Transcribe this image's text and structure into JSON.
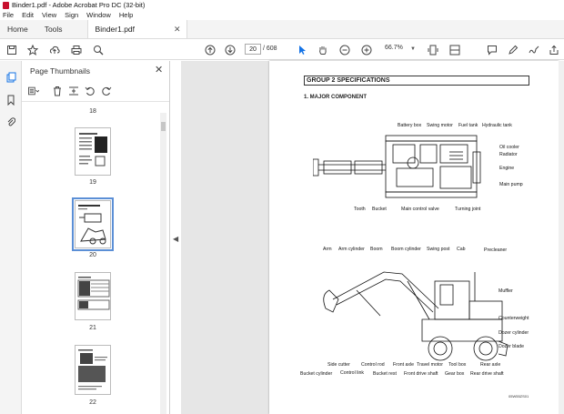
{
  "window": {
    "title": "Binder1.pdf - Adobe Acrobat Pro DC (32-bit)"
  },
  "menu": [
    "File",
    "Edit",
    "View",
    "Sign",
    "Window",
    "Help"
  ],
  "tabs": {
    "home": "Home",
    "tools": "Tools",
    "doc": "Binder1.pdf"
  },
  "toolbar": {
    "page_current": "20",
    "page_total": "/ 608",
    "zoom": "66.7%"
  },
  "thumbnails": {
    "title": "Page Thumbnails",
    "pages": [
      {
        "label": "18"
      },
      {
        "label": "19"
      },
      {
        "label": "20"
      },
      {
        "label": "21"
      },
      {
        "label": "22"
      }
    ]
  },
  "document": {
    "heading": "GROUP 2  SPECIFICATIONS",
    "subheading": "1. MAJOR COMPONENT",
    "top_labels": [
      "Battery box",
      "Swing motor",
      "Fuel tank",
      "Hydraulic tank",
      "Oil cooler",
      "Radiator",
      "Engine",
      "Main pump",
      "Tooth",
      "Bucket",
      "Main control valve",
      "Turning joint"
    ],
    "side_labels": [
      "Arm",
      "Arm cylinder",
      "Boom",
      "Boom cylinder",
      "Swing post",
      "Cab",
      "Precleaner",
      "Muffler",
      "Counterweight",
      "Dozer cylinder",
      "Dozer blade",
      "Side cutter",
      "Control rod",
      "Front axle",
      "Travel motor",
      "Tool box",
      "Rear axle",
      "Bucket cylinder",
      "Control link",
      "Bucket rest",
      "Front drive shaft",
      "Gear box",
      "Rear drive shaft"
    ],
    "figure_code": "05W55ZS01"
  },
  "colors": {
    "accent": "#c8102e",
    "selection": "#5b8fd6",
    "cursor_blue": "#1473e6"
  }
}
